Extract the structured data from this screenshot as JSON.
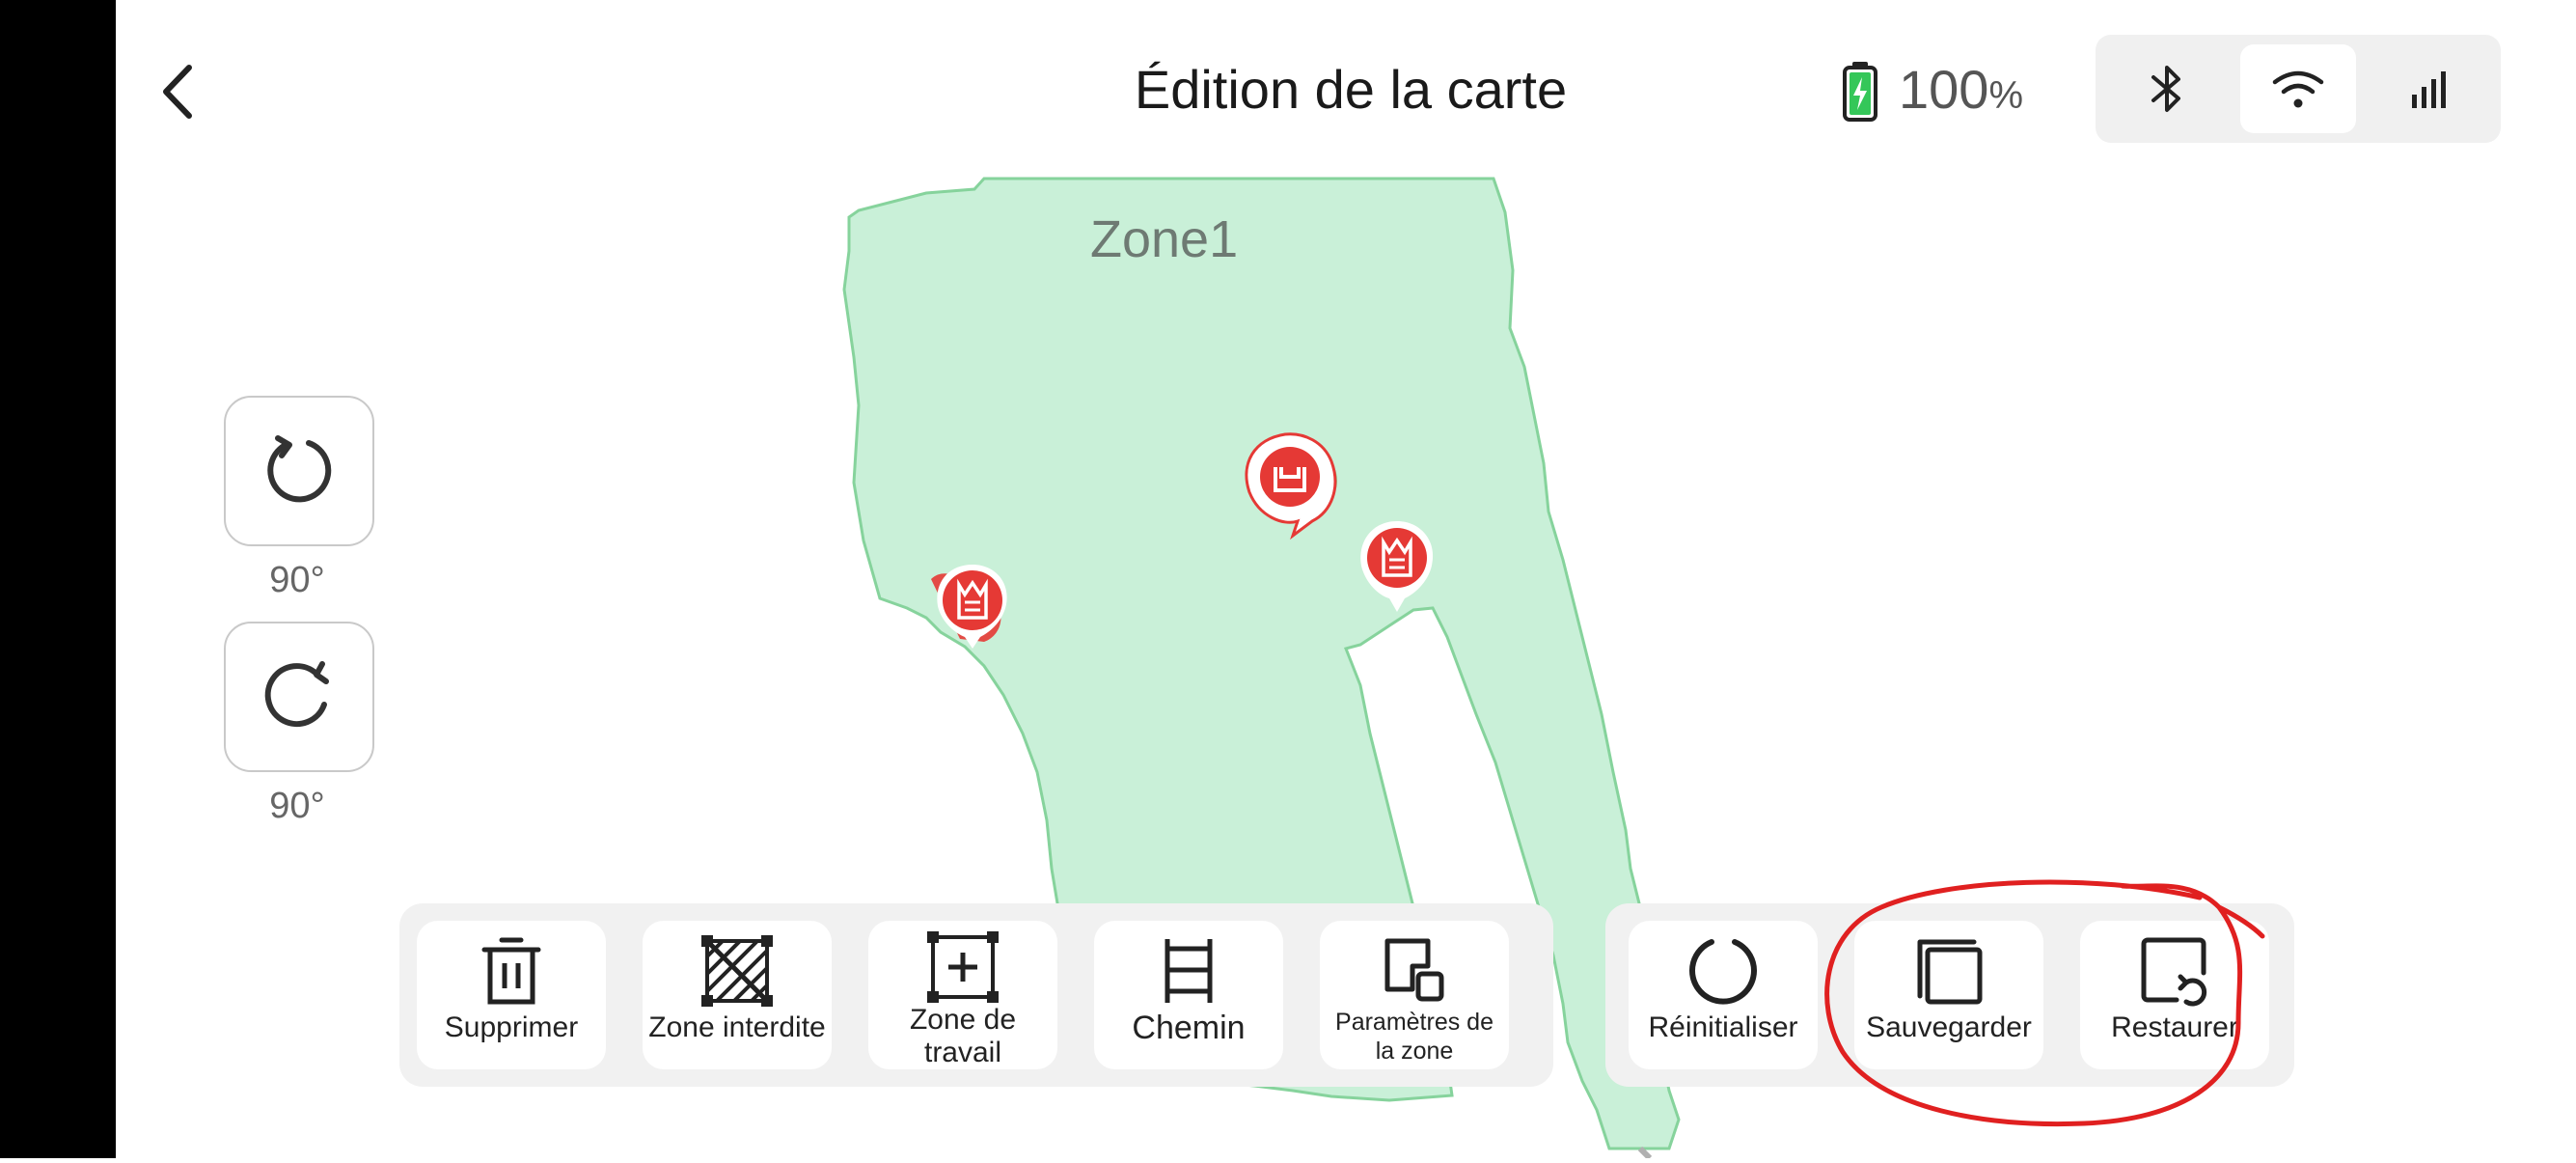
{
  "header": {
    "title": "Édition de la carte",
    "battery_value": "100",
    "battery_unit": "%"
  },
  "map": {
    "zone_name": "Zone1",
    "colors": {
      "zone_fill": "#c9f0d8",
      "zone_border": "#86d39c",
      "marker_red": "#e53935"
    }
  },
  "rotation": {
    "left_label": "90°",
    "right_label": "90°"
  },
  "toolbar_left": [
    {
      "label": "Supprimer",
      "icon": "trash-icon"
    },
    {
      "label": "Zone interdite",
      "icon": "forbidden-zone-icon"
    },
    {
      "label": "Zone de travail",
      "icon": "work-zone-icon"
    },
    {
      "label": "Chemin",
      "icon": "path-ladder-icon"
    },
    {
      "label": "Paramètres de la zone",
      "icon": "zone-settings-icon"
    }
  ],
  "toolbar_right": [
    {
      "label": "Réinitialiser",
      "icon": "reset-icon"
    },
    {
      "label": "Sauvegarder",
      "icon": "save-copy-icon"
    },
    {
      "label": "Restaurer",
      "icon": "restore-icon"
    }
  ],
  "annotation_color": "#e02020"
}
